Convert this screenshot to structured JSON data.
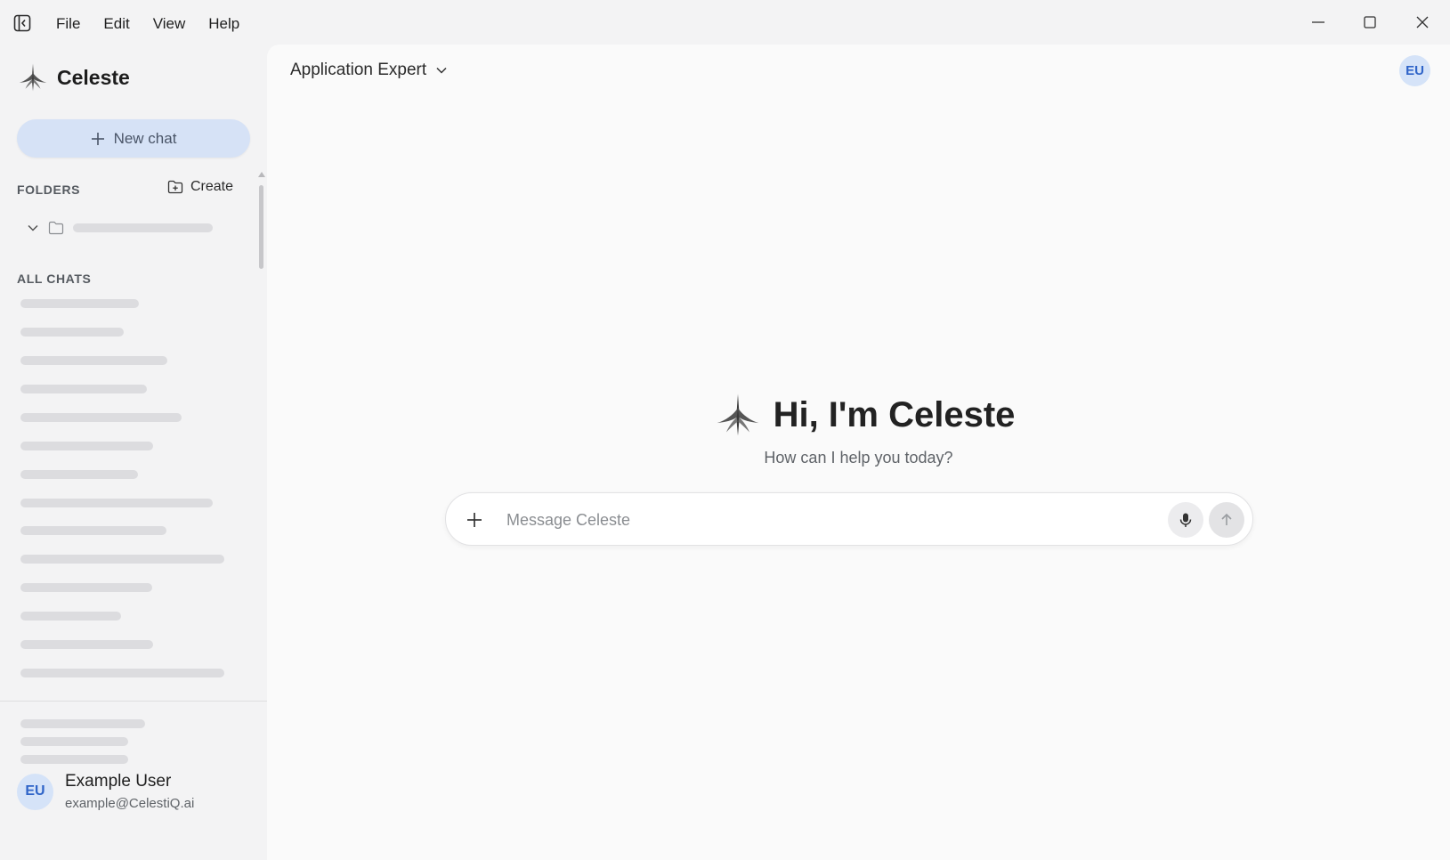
{
  "menu": {
    "items": [
      {
        "label": "File"
      },
      {
        "label": "Edit"
      },
      {
        "label": "View"
      },
      {
        "label": "Help"
      }
    ]
  },
  "sidebar": {
    "brand": "Celeste",
    "new_chat_label": "New chat",
    "folders_label": "FOLDERS",
    "create_label": "Create",
    "all_chats_label": "ALL CHATS"
  },
  "user": {
    "initials": "EU",
    "name": "Example User",
    "email": "example@CelestiQ.ai"
  },
  "main": {
    "model_name": "Application Expert",
    "greeting": "Hi, I'm Celeste",
    "subtitle": "How can I help you today?",
    "composer_placeholder": "Message Celeste"
  },
  "colors": {
    "accent": "#2f64c8",
    "new_chat_bg": "#d6e2f6",
    "avatar_bg": "#d5e3f8"
  }
}
